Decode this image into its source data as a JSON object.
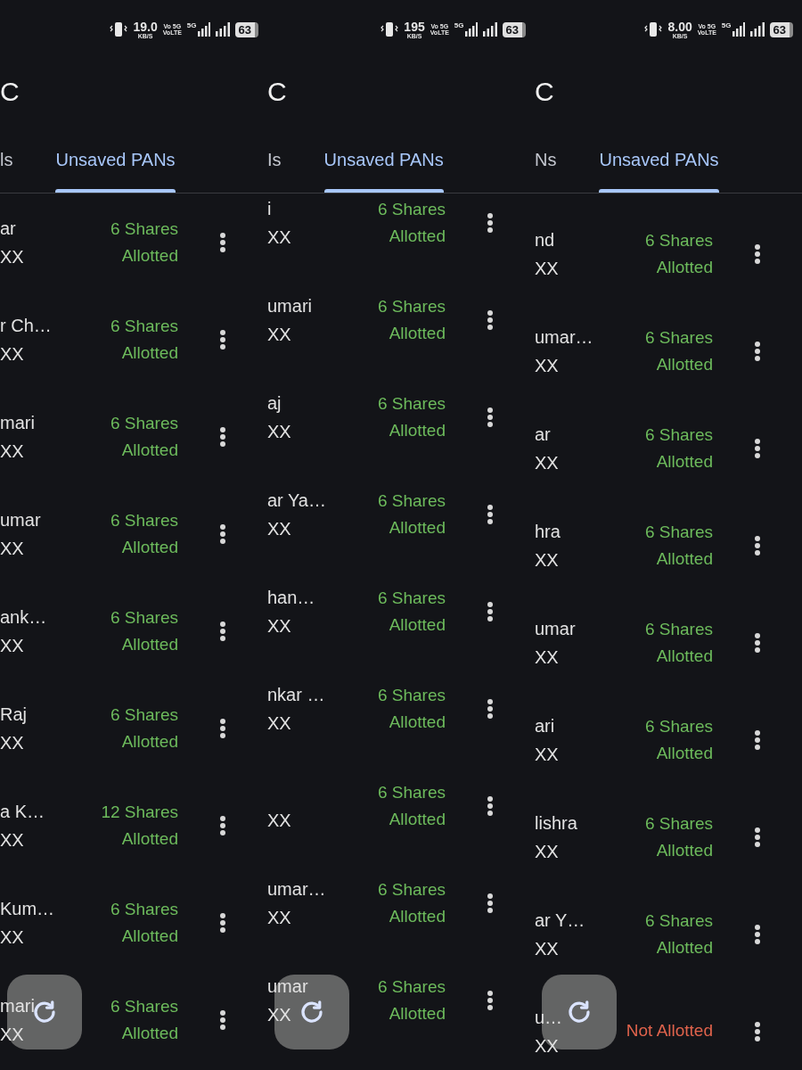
{
  "panels": [
    {
      "status_bar": {
        "speed": "19.0",
        "speed_unit": "KB/S",
        "volte_top": "Vo 5G",
        "volte_bottom": "VoLTE",
        "network": "5G",
        "battery": "63"
      },
      "title": "C",
      "tabs": [
        {
          "label": "ls",
          "selected": false
        },
        {
          "label": "Unsaved PANs",
          "selected": true
        }
      ],
      "rows": [
        {
          "name": "ar",
          "pan": "XX",
          "kind": "allotted",
          "shares": "6 Shares",
          "status": "Allotted"
        },
        {
          "name": "r Ch…",
          "pan": "XX",
          "kind": "allotted",
          "shares": "6 Shares",
          "status": "Allotted"
        },
        {
          "name": "mari",
          "pan": "XX",
          "kind": "allotted",
          "shares": "6 Shares",
          "status": "Allotted"
        },
        {
          "name": "umar",
          "pan": "XX",
          "kind": "allotted",
          "shares": "6 Shares",
          "status": "Allotted"
        },
        {
          "name": "ank…",
          "pan": "XX",
          "kind": "allotted",
          "shares": "6 Shares",
          "status": "Allotted"
        },
        {
          "name": "Raj",
          "pan": "XX",
          "kind": "allotted",
          "shares": "6 Shares",
          "status": "Allotted"
        },
        {
          "name": "a K…",
          "pan": "XX",
          "kind": "allotted",
          "shares": "12 Shares",
          "status": "Allotted"
        },
        {
          "name": "Kum…",
          "pan": "XX",
          "kind": "allotted",
          "shares": "6 Shares",
          "status": "Allotted"
        },
        {
          "name": "mari",
          "pan": "XX",
          "kind": "allotted",
          "shares": "6 Shares",
          "status": "Allotted"
        }
      ]
    },
    {
      "status_bar": {
        "speed": "195",
        "speed_unit": "KB/S",
        "volte_top": "Vo 5G",
        "volte_bottom": "VoLTE",
        "network": "5G",
        "battery": "63"
      },
      "title": "C",
      "tabs": [
        {
          "label": "Is",
          "selected": false
        },
        {
          "label": "Unsaved PANs",
          "selected": true
        }
      ],
      "rows": [
        {
          "name": "i",
          "pan": "XX",
          "kind": "allotted",
          "shares": "6 Shares",
          "status": "Allotted"
        },
        {
          "name": "umari",
          "pan": "XX",
          "kind": "allotted",
          "shares": "6 Shares",
          "status": "Allotted"
        },
        {
          "name": "aj",
          "pan": "XX",
          "kind": "allotted",
          "shares": "6 Shares",
          "status": "Allotted"
        },
        {
          "name": "ar Ya…",
          "pan": "XX",
          "kind": "allotted",
          "shares": "6 Shares",
          "status": "Allotted"
        },
        {
          "name": "han…",
          "pan": "XX",
          "kind": "allotted",
          "shares": "6 Shares",
          "status": "Allotted"
        },
        {
          "name": "nkar …",
          "pan": "XX",
          "kind": "allotted",
          "shares": "6 Shares",
          "status": "Allotted"
        },
        {
          "pan": "XX",
          "kind": "allotted",
          "shares": "6 Shares",
          "status": "Allotted"
        },
        {
          "name": "umar…",
          "pan": "XX",
          "kind": "allotted",
          "shares": "6 Shares",
          "status": "Allotted"
        },
        {
          "name": "umar",
          "pan": "XX",
          "kind": "allotted",
          "shares": "6 Shares",
          "status": "Allotted"
        }
      ]
    },
    {
      "status_bar": {
        "speed": "8.00",
        "speed_unit": "KB/S",
        "volte_top": "Vo 5G",
        "volte_bottom": "VoLTE",
        "network": "5G",
        "battery": "63"
      },
      "title": "C",
      "tabs": [
        {
          "label": "Ns",
          "selected": false
        },
        {
          "label": "Unsaved PANs",
          "selected": true
        }
      ],
      "rows": [
        {
          "name": "nd",
          "pan": "XX",
          "kind": "allotted",
          "shares": "6 Shares",
          "status": "Allotted"
        },
        {
          "name": "umar…",
          "pan": "XX",
          "kind": "allotted",
          "shares": "6 Shares",
          "status": "Allotted"
        },
        {
          "name": "ar",
          "pan": "XX",
          "kind": "allotted",
          "shares": "6 Shares",
          "status": "Allotted"
        },
        {
          "name": "hra",
          "pan": "XX",
          "kind": "allotted",
          "shares": "6 Shares",
          "status": "Allotted"
        },
        {
          "name": "umar",
          "pan": "XX",
          "kind": "allotted",
          "shares": "6 Shares",
          "status": "Allotted"
        },
        {
          "name": "ari",
          "pan": "XX",
          "kind": "allotted",
          "shares": "6 Shares",
          "status": "Allotted"
        },
        {
          "name": "lishra",
          "pan": "XX",
          "kind": "allotted",
          "shares": "6 Shares",
          "status": "Allotted"
        },
        {
          "name": "ar Y…",
          "pan": "XX",
          "kind": "allotted",
          "shares": "6 Shares",
          "status": "Allotted"
        },
        {
          "name": "u…",
          "pan": "XX",
          "kind": "not_allotted",
          "status": "Not Allotted"
        }
      ]
    }
  ]
}
